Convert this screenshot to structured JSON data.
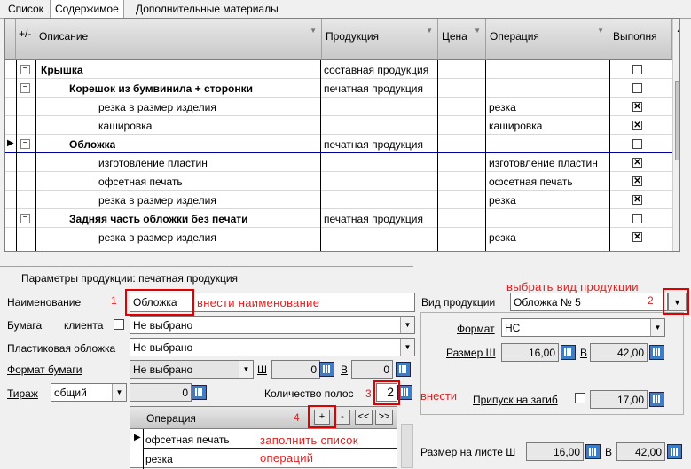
{
  "tabs": [
    "Список",
    "Содержимое",
    "Дополнительные материалы"
  ],
  "grid": {
    "columns": [
      "+/-",
      "Описание",
      "Продукция",
      "Цена",
      "Операция",
      "Выполня"
    ],
    "rows": [
      {
        "level": 1,
        "expander": "−",
        "desc": "Крышка",
        "product": "составная продукция",
        "op": "",
        "checked": false,
        "bold": true
      },
      {
        "level": 2,
        "expander": "−",
        "desc": "Корешок из бумвинила + сторонки",
        "product": "печатная продукция",
        "op": "",
        "checked": false,
        "bold": true
      },
      {
        "level": 3,
        "expander": "",
        "desc": "резка в размер изделия",
        "product": "",
        "op": "резка",
        "checked": true,
        "bold": false
      },
      {
        "level": 3,
        "expander": "",
        "desc": "кашировка",
        "product": "",
        "op": "кашировка",
        "checked": true,
        "bold": false
      },
      {
        "level": 2,
        "expander": "−",
        "desc": "Обложка",
        "product": "печатная продукция",
        "op": "",
        "checked": false,
        "bold": true,
        "current": true
      },
      {
        "level": 3,
        "expander": "",
        "desc": "изготовление пластин",
        "product": "",
        "op": "изготовление пластин",
        "checked": true,
        "bold": false
      },
      {
        "level": 3,
        "expander": "",
        "desc": "офсетная печать",
        "product": "",
        "op": "офсетная печать",
        "checked": true,
        "bold": false
      },
      {
        "level": 3,
        "expander": "",
        "desc": "резка в размер изделия",
        "product": "",
        "op": "резка",
        "checked": true,
        "bold": false
      },
      {
        "level": 2,
        "expander": "−",
        "desc": "Задняя часть обложки без печати",
        "product": "печатная продукция",
        "op": "",
        "checked": false,
        "bold": true
      },
      {
        "level": 3,
        "expander": "",
        "desc": "резка в размер изделия",
        "product": "",
        "op": "резка",
        "checked": true,
        "bold": false
      }
    ]
  },
  "params": {
    "title": "Параметры продукции: печатная продукция",
    "name_label": "Наименование",
    "name_value": "Обложка",
    "paper_label": "Бумага",
    "client_label": "клиента",
    "paper_value": "Не выбрано",
    "plastic_label": "Пластиковая обложка",
    "plastic_value": "Не выбрано",
    "format_label": "Формат бумаги",
    "format_value": "Не выбрано",
    "w_label": "Ш",
    "w_value": "0",
    "h_label": "В",
    "h_value": "0",
    "run_label": "Тираж",
    "run_type": "общий",
    "run_value": "0",
    "pages_label": "Количество полос",
    "pages_value": "2"
  },
  "ops_table": {
    "header": "Операция",
    "buttons": [
      "+",
      "-",
      "<<",
      ">>"
    ],
    "rows": [
      "офсетная печать",
      "резка"
    ]
  },
  "right": {
    "kind_label": "Вид продукции",
    "kind_value": "Обложка № 5",
    "format_label": "Формат",
    "format_value": "НС",
    "size_label": "Размер Ш",
    "size_w": "16,00",
    "size_h_label": "В",
    "size_h": "42,00",
    "fold_label": "Припуск на загиб",
    "fold_value": "17,00",
    "sheet_label": "Размер на листе Ш",
    "sheet_w": "16,00",
    "sheet_h_label": "В",
    "sheet_h": "42,00"
  },
  "annotations": {
    "n1": "1",
    "t1": "внести наименование",
    "n2": "2",
    "t2": "выбрать вид продукции",
    "n3": "3",
    "t3": "внести",
    "n4": "4",
    "t4a": "заполнить список",
    "t4b": "операций"
  },
  "colors": {
    "annotation": "#e02020",
    "current_row_line": "#0000a0"
  }
}
